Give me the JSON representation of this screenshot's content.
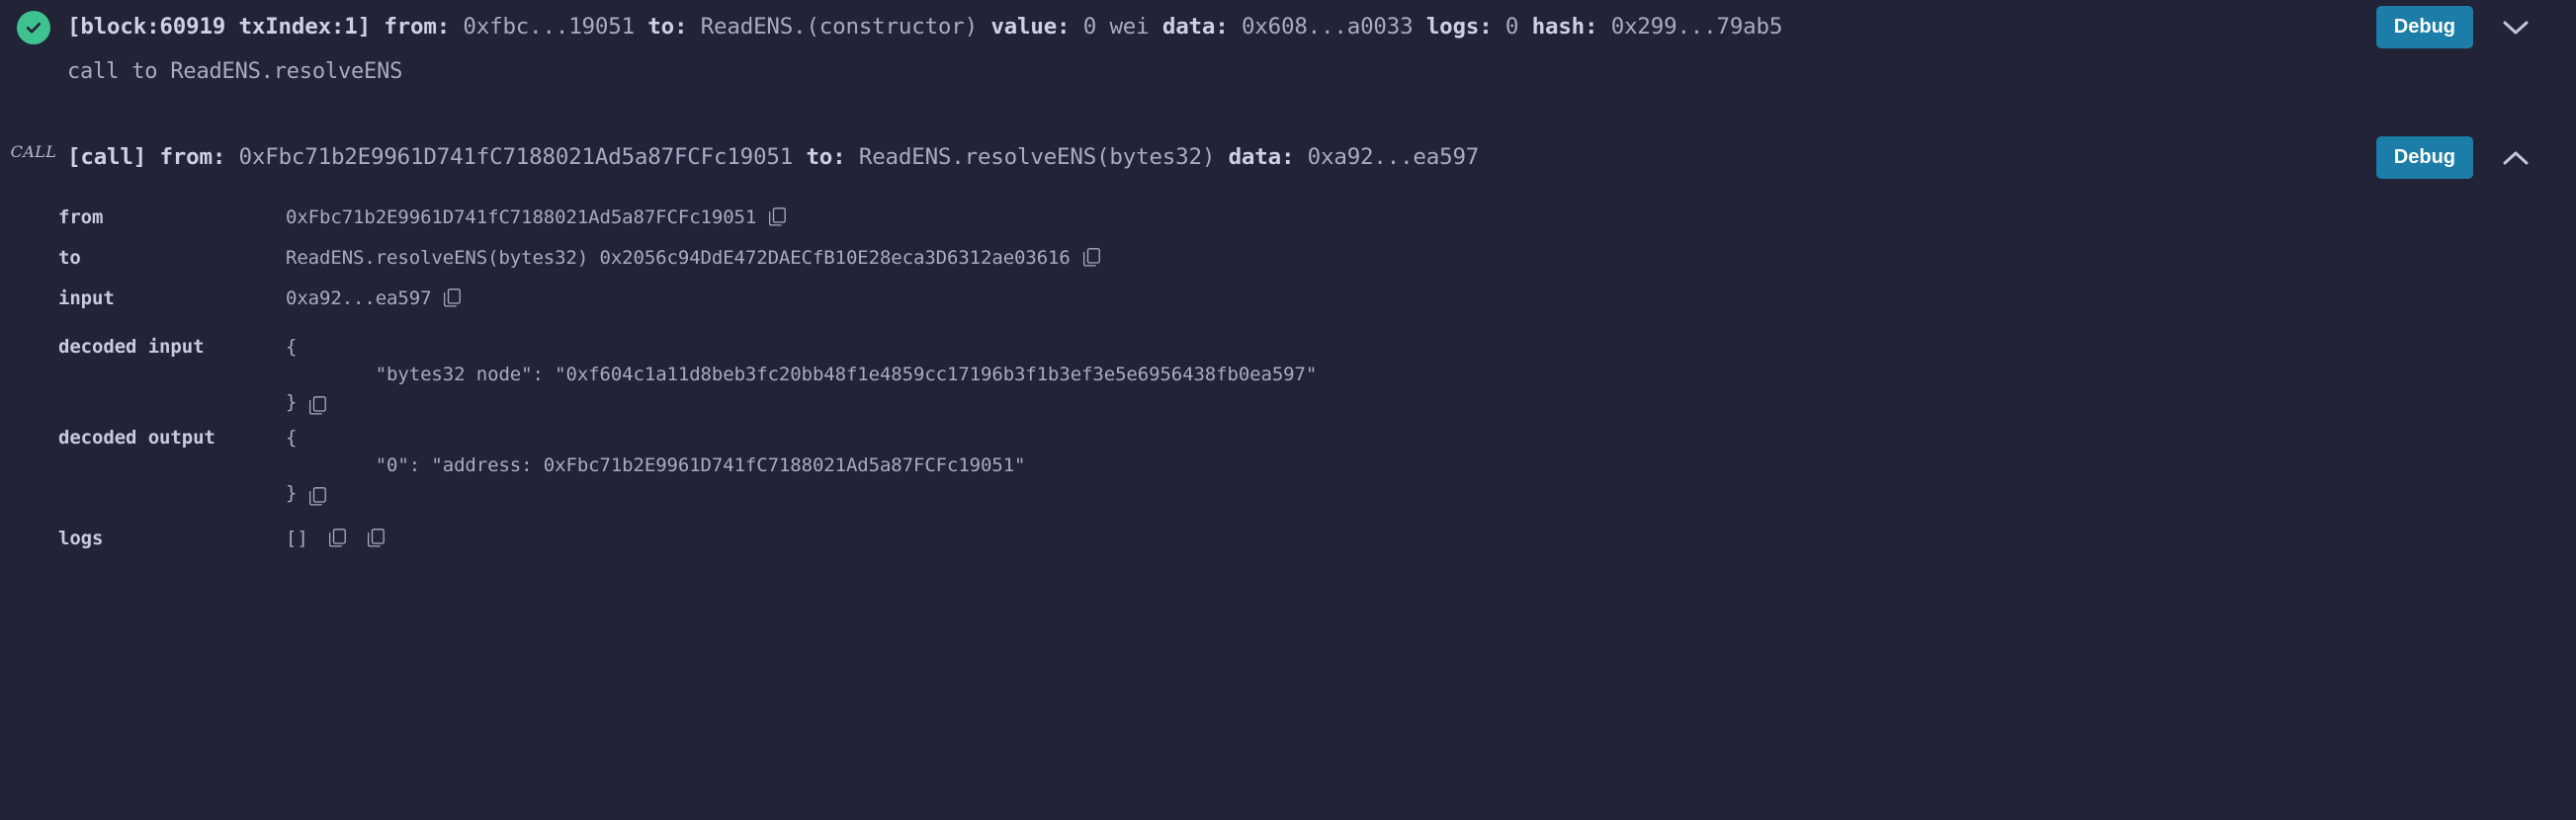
{
  "theme": {
    "background": "#222336",
    "text": "#a7abc4",
    "text_strong": "#ced1e3",
    "success_green": "#3ec28f",
    "debug_blue": "#1c7ea8"
  },
  "entries": [
    {
      "status_icon": "check-circle-icon",
      "header": {
        "block_label": "[block:60919 txIndex:1]",
        "from_key": "from:",
        "from_value": "0xfbc...19051",
        "to_key": "to:",
        "to_value": "ReadENS.(constructor)",
        "value_key": "value:",
        "value_value": "0 wei",
        "data_key": "data:",
        "data_value": "0x608...a0033",
        "logs_key": "logs:",
        "logs_value": "0",
        "hash_key": "hash:",
        "hash_value": "0x299...79ab5"
      },
      "debug_label": "Debug",
      "toggle_icon": "chevron-down-icon",
      "sub_line": "call to ReadENS.resolveENS"
    },
    {
      "badge": "call",
      "header": {
        "call_label": "[call]",
        "from_key": "from:",
        "from_value": "0xFbc71b2E9961D741fC7188021Ad5a87FCFc19051",
        "to_key": "to:",
        "to_value": "ReadENS.resolveENS(bytes32)",
        "data_key": "data:",
        "data_value": "0xa92...ea597"
      },
      "debug_label": "Debug",
      "toggle_icon": "chevron-up-icon",
      "details": [
        {
          "key": "from",
          "type": "text",
          "value": "0xFbc71b2E9961D741fC7188021Ad5a87FCFc19051",
          "copy": 1
        },
        {
          "key": "to",
          "type": "text",
          "value": "ReadENS.resolveENS(bytes32) 0x2056c94DdE472DAECfB10E28eca3D6312ae03616",
          "copy": 1
        },
        {
          "key": "input",
          "type": "text",
          "value": "0xa92...ea597",
          "copy": 1
        },
        {
          "key": "decoded input",
          "type": "json",
          "open": "{",
          "body": "\t\"bytes32 node\": \"0xf604c1a11d8beb3fc20bb48f1e4859cc17196b3f1b3ef3e5e6956438fb0ea597\"",
          "close": "}",
          "copy": 1
        },
        {
          "key": "decoded output",
          "type": "json",
          "open": "{",
          "body": "\t\"0\": \"address: 0xFbc71b2E9961D741fC7188021Ad5a87FCFc19051\"",
          "close": "}",
          "copy": 1
        },
        {
          "key": "logs",
          "type": "text",
          "value": "[]",
          "copy": 2
        }
      ]
    }
  ]
}
